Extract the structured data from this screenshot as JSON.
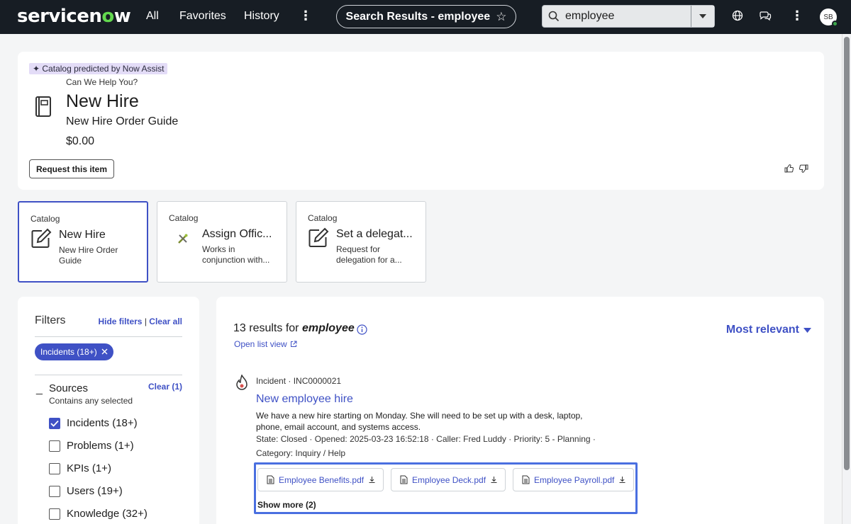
{
  "topnav": {
    "logo_pre": "servicen",
    "logo_o": "o",
    "logo_post": "w",
    "all": "All",
    "favorites": "Favorites",
    "history": "History",
    "page_title": "Search Results - employee",
    "search_value": "employee",
    "avatar_initials": "SB"
  },
  "featured": {
    "badge": "Catalog predicted by Now Assist",
    "subtitle": "Can We Help You?",
    "title": "New Hire",
    "description": "New Hire Order Guide",
    "price": "$0.00",
    "request_label": "Request this item"
  },
  "catalog_cards": [
    {
      "type": "Catalog",
      "title": "New Hire",
      "desc": "New Hire Order Guide",
      "icon": "edit-icon"
    },
    {
      "type": "Catalog",
      "title": "Assign Offic...",
      "desc": "Works in conjunction with...",
      "icon": "tools-icon"
    },
    {
      "type": "Catalog",
      "title": "Set a delegat...",
      "desc": "Request for delegation for a...",
      "icon": "edit-icon"
    }
  ],
  "filters": {
    "title": "Filters",
    "hide": "Hide filters",
    "sep": "|",
    "clear_all": "Clear all",
    "chip": "Incidents (18+)",
    "sources_title": "Sources",
    "sources_sub": "Contains any selected",
    "sources_clear": "Clear (1)",
    "collapse": "_",
    "options": [
      {
        "label": "Incidents (18+)",
        "checked": true
      },
      {
        "label": "Problems (1+)",
        "checked": false
      },
      {
        "label": "KPIs (1+)",
        "checked": false
      },
      {
        "label": "Users (19+)",
        "checked": false
      },
      {
        "label": "Knowledge (32+)",
        "checked": false
      }
    ]
  },
  "results": {
    "count_prefix": "13 results for",
    "query": "employee",
    "open_list": "Open list view",
    "sort": "Most relevant",
    "item": {
      "meta": "Incident · INC0000021",
      "title": "New employee hire",
      "body": "We have a new hire starting on Monday. She will need to be set up with a desk, laptop, phone, email account, and systems access.",
      "state": "State: Closed · Opened: 2025-03-23 16:52:18 · Caller: Fred Luddy · Priority: 5 - Planning ·",
      "category": "Category: Inquiry / Help",
      "attachments": [
        "Employee Benefits.pdf",
        "Employee Deck.pdf",
        "Employee Payroll.pdf"
      ],
      "show_more": "Show more (2)"
    }
  },
  "colors": {
    "accent": "#3f51c5",
    "nav_bg": "#171d24",
    "logo_green": "#62d84e"
  }
}
